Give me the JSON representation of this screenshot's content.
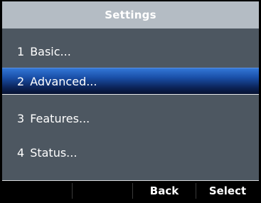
{
  "header": {
    "title": "Settings"
  },
  "menu": {
    "items": [
      {
        "number": "1",
        "label": "Basic...",
        "selected": false
      },
      {
        "number": "2",
        "label": "Advanced...",
        "selected": true
      },
      {
        "number": "3",
        "label": "Features...",
        "selected": false
      },
      {
        "number": "4",
        "label": "Status...",
        "selected": false
      }
    ]
  },
  "softkeys": {
    "back_label": "Back",
    "select_label": "Select"
  },
  "colors": {
    "background": "#4d5761",
    "title_bar": "#b4bcc4",
    "selection": "#1a4fa8",
    "softkey_bar": "#000000"
  }
}
